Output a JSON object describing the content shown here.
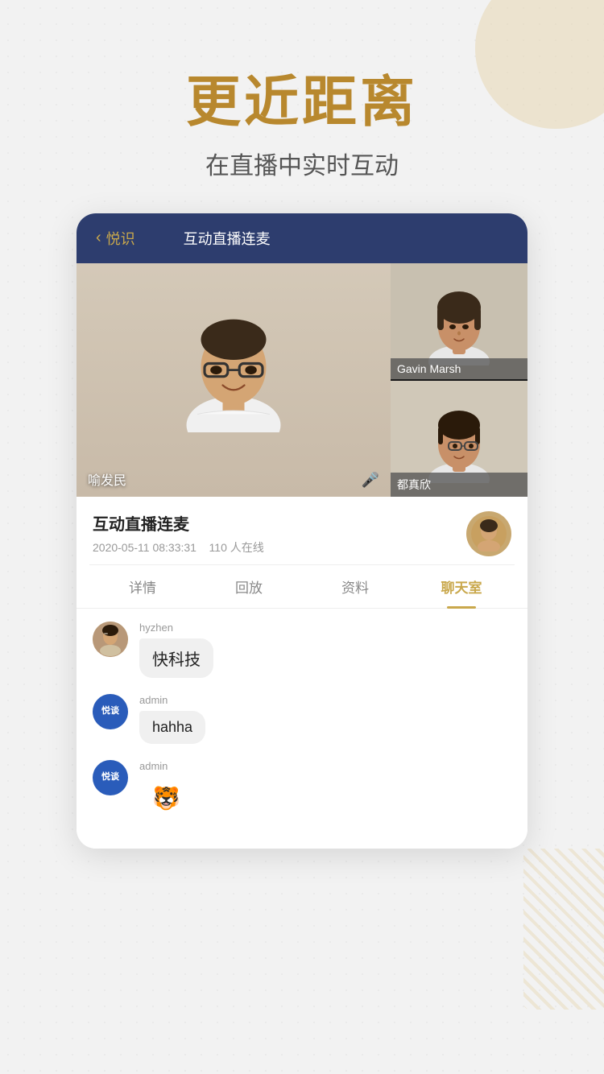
{
  "background": {
    "dotColor": "#ccc"
  },
  "header": {
    "mainTitle": "更近距离",
    "subTitle": "在直播中实时互动"
  },
  "navbar": {
    "backIcon": "‹",
    "backLabel": "悦识",
    "title": "互动直播连麦"
  },
  "videoGrid": {
    "mainPerson": {
      "name": "喻发民",
      "hasMic": true
    },
    "sidePeople": [
      {
        "name": "Gavin Marsh"
      },
      {
        "name": "都真欣"
      }
    ]
  },
  "sessionInfo": {
    "title": "互动直播连麦",
    "date": "2020-05-11 08:33:31",
    "online": "110 人在线"
  },
  "tabs": [
    {
      "label": "详情",
      "active": false
    },
    {
      "label": "回放",
      "active": false
    },
    {
      "label": "资料",
      "active": false
    },
    {
      "label": "聊天室",
      "active": true
    }
  ],
  "chat": {
    "messages": [
      {
        "username": "hyzhen",
        "avatarType": "photo",
        "bubble": "快科技",
        "isEmoji": false
      },
      {
        "username": "admin",
        "avatarType": "blue",
        "avatarText": "悦谈",
        "bubble": "hahha",
        "isEmoji": false
      },
      {
        "username": "admin",
        "avatarType": "blue",
        "avatarText": "悦谈",
        "bubble": "🐯",
        "isEmoji": true
      }
    ]
  }
}
